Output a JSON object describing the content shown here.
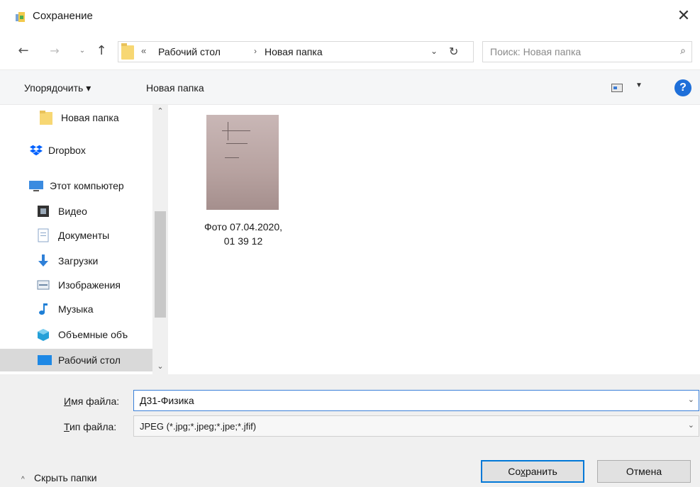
{
  "window": {
    "title": "Сохранение",
    "close_glyph": "✕",
    "app_icon": "save-dialog-icon"
  },
  "nav": {
    "back_glyph": "←",
    "forward_glyph": "→",
    "recent_glyph": "⌄",
    "up_glyph": "↑",
    "address": {
      "overflow_glyph": "«",
      "crumbs": [
        "Рабочий стол",
        "Новая папка"
      ],
      "separator": "›",
      "dropdown_glyph": "⌄",
      "refresh_glyph": "↻"
    },
    "search": {
      "placeholder": "Поиск: Новая папка",
      "value": "",
      "icon_glyph": "⌕"
    }
  },
  "toolbar": {
    "organize_label": "Упорядочить ▾",
    "new_folder_label": "Новая папка",
    "view_dropdown_glyph": "▼",
    "help_glyph": "?"
  },
  "sidebar": {
    "items": [
      {
        "label": "Новая папка",
        "icon": "folder-icon",
        "color": "#f7d773"
      },
      {
        "label": "Dropbox",
        "icon": "dropbox-icon",
        "color": "#0061fe"
      },
      {
        "label": "Этот компьютер",
        "icon": "computer-icon",
        "color": "#3b8be0"
      },
      {
        "label": "Видео",
        "icon": "video-icon",
        "color": "#333333"
      },
      {
        "label": "Документы",
        "icon": "documents-icon",
        "color": "#8aa6c9"
      },
      {
        "label": "Загрузки",
        "icon": "downloads-icon",
        "color": "#2f80d8"
      },
      {
        "label": "Изображения",
        "icon": "pictures-icon",
        "color": "#6f8aa8"
      },
      {
        "label": "Музыка",
        "icon": "music-icon",
        "color": "#1e7fd6"
      },
      {
        "label": "Объемные объ",
        "icon": "3d-objects-icon",
        "color": "#24a0d8"
      },
      {
        "label": "Рабочий стол",
        "icon": "desktop-icon",
        "color": "#1e88e5"
      }
    ],
    "scroll_up_glyph": "⌃",
    "scroll_down_glyph": "⌄"
  },
  "files": [
    {
      "name_line1": "Фото 07.04.2020,",
      "name_line2": "01 39 12"
    }
  ],
  "form": {
    "filename_label_underlined": "И",
    "filename_label_rest": "мя файла:",
    "filename_value": "Д31-Физика",
    "filetype_label_underlined": "Т",
    "filetype_label_rest": "ип файла:",
    "filetype_value": "JPEG (*.jpg;*.jpeg;*.jpe;*.jfif)",
    "dropdown_glyph": "⌄"
  },
  "footer": {
    "hide_folders_glyph": "^",
    "hide_folders_label": "Скрыть папки",
    "save_label_pre": "Со",
    "save_label_underlined": "х",
    "save_label_post": "ранить",
    "cancel_label": "Отмена"
  },
  "colors": {
    "accent": "#0078d7",
    "help": "#1e6fd9",
    "toolbar_bg": "#f5f6f7",
    "bottom_bg": "#f0f0f0"
  }
}
